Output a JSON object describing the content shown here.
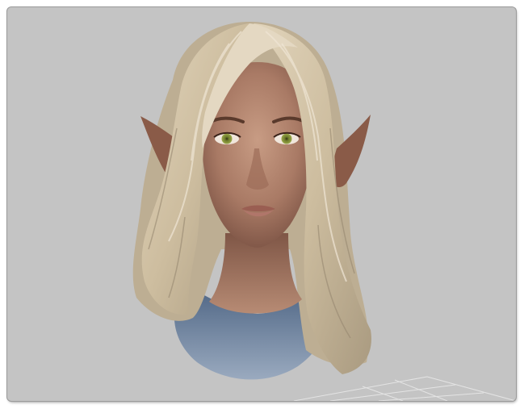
{
  "viewport": {
    "subject": "character-head",
    "background_color": "#c4c4c4",
    "hair_color": "#d2c3a6",
    "skin_color": "#b98f79",
    "eye_color": "#8a9a3e",
    "shirt_color": "#6f84a2",
    "floor_grid_color": "#e8e8e8"
  }
}
